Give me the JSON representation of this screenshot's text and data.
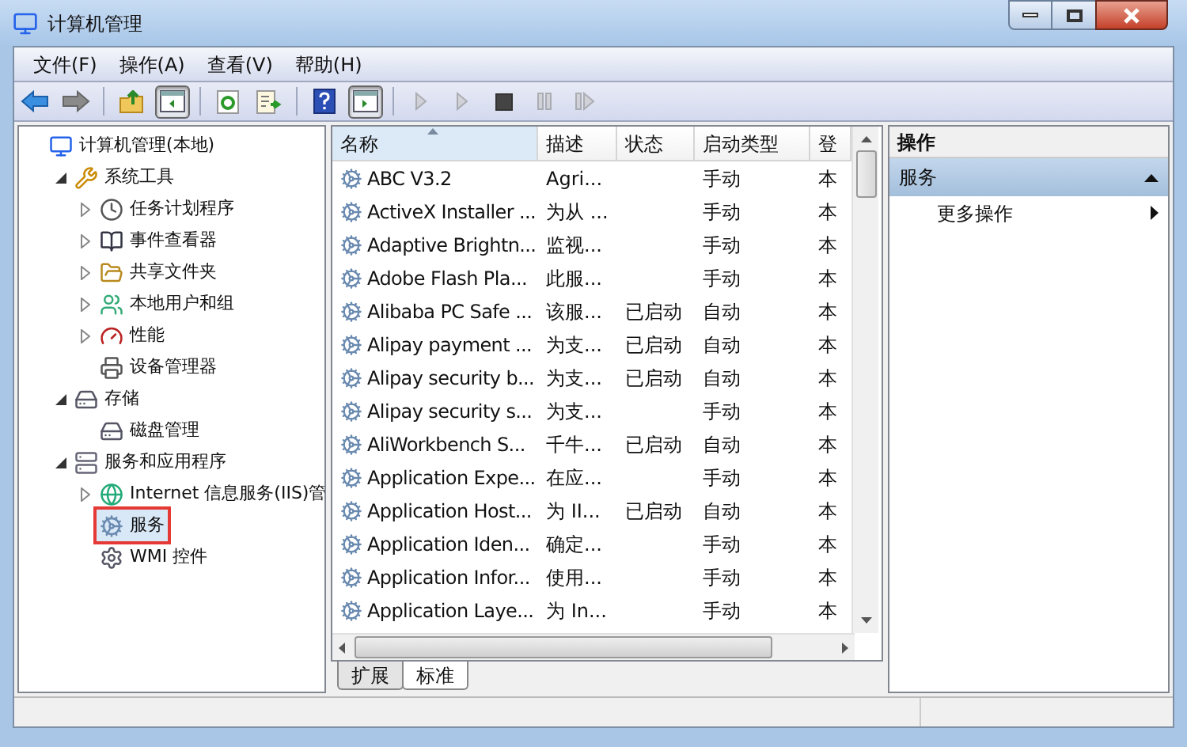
{
  "window": {
    "title": "计算机管理"
  },
  "menu": [
    "文件(F)",
    "操作(A)",
    "查看(V)",
    "帮助(H)"
  ],
  "toolbar": [
    {
      "kind": "back",
      "pressed": false,
      "disabled": false
    },
    {
      "kind": "forward",
      "pressed": false,
      "disabled": false
    },
    {
      "kind": "sep"
    },
    {
      "kind": "up",
      "pressed": false,
      "disabled": false
    },
    {
      "kind": "tree",
      "pressed": true,
      "disabled": false
    },
    {
      "kind": "sep"
    },
    {
      "kind": "refresh",
      "pressed": false,
      "disabled": false
    },
    {
      "kind": "export",
      "pressed": false,
      "disabled": false
    },
    {
      "kind": "sep"
    },
    {
      "kind": "help",
      "pressed": false,
      "disabled": false
    },
    {
      "kind": "pane",
      "pressed": true,
      "disabled": false
    },
    {
      "kind": "sep"
    },
    {
      "kind": "play",
      "pressed": false,
      "disabled": true
    },
    {
      "kind": "play",
      "pressed": false,
      "disabled": true
    },
    {
      "kind": "stop",
      "pressed": false,
      "disabled": false
    },
    {
      "kind": "pause",
      "pressed": false,
      "disabled": true
    },
    {
      "kind": "resume",
      "pressed": false,
      "disabled": true
    }
  ],
  "tree": [
    {
      "label": "计算机管理(本地)",
      "kind": "node",
      "selected": false,
      "marked": false,
      "children": [
        {
          "label": "系统工具",
          "kind": "branch",
          "expanded": true,
          "selected": false,
          "marked": false,
          "children": [
            {
              "label": "任务计划程序",
              "kind": "branch",
              "expanded": false,
              "selected": false,
              "marked": false
            },
            {
              "label": "事件查看器",
              "kind": "branch",
              "expanded": false,
              "selected": false,
              "marked": false
            },
            {
              "label": "共享文件夹",
              "kind": "branch",
              "expanded": false,
              "selected": false,
              "marked": false
            },
            {
              "label": "本地用户和组",
              "kind": "branch",
              "expanded": false,
              "selected": false,
              "marked": false
            },
            {
              "label": "性能",
              "kind": "branch",
              "expanded": false,
              "selected": false,
              "marked": false
            },
            {
              "label": "设备管理器",
              "kind": "node",
              "selected": false,
              "marked": false
            }
          ]
        },
        {
          "label": "存储",
          "kind": "branch",
          "expanded": true,
          "selected": false,
          "marked": false,
          "children": [
            {
              "label": "磁盘管理",
              "kind": "node",
              "selected": false,
              "marked": false
            }
          ]
        },
        {
          "label": "服务和应用程序",
          "kind": "branch",
          "expanded": true,
          "selected": false,
          "marked": false,
          "children": [
            {
              "label": "Internet 信息服务(IIS)管",
              "kind": "branch",
              "expanded": false,
              "selected": false,
              "marked": false
            },
            {
              "label": "服务",
              "kind": "node",
              "selected": true,
              "marked": true
            },
            {
              "label": "WMI 控件",
              "kind": "node",
              "selected": false,
              "marked": false
            }
          ]
        }
      ]
    }
  ],
  "table": {
    "columns": [
      {
        "label": "名称",
        "sorted": true
      },
      {
        "label": "描述",
        "sorted": false
      },
      {
        "label": "状态",
        "sorted": false
      },
      {
        "label": "启动类型",
        "sorted": false
      },
      {
        "label": "登",
        "sorted": false
      }
    ],
    "rows": [
      [
        "ABC V3.2",
        "Agri...",
        "",
        "手动",
        "本"
      ],
      [
        "ActiveX Installer ...",
        "为从 ...",
        "",
        "手动",
        "本"
      ],
      [
        "Adaptive Brightn...",
        "监视...",
        "",
        "手动",
        "本"
      ],
      [
        "Adobe Flash Pla...",
        "此服...",
        "",
        "手动",
        "本"
      ],
      [
        "Alibaba PC Safe ...",
        "该服...",
        "已启动",
        "自动",
        "本"
      ],
      [
        "Alipay payment ...",
        "为支...",
        "已启动",
        "自动",
        "本"
      ],
      [
        "Alipay security b...",
        "为支...",
        "已启动",
        "自动",
        "本"
      ],
      [
        "Alipay security s...",
        "为支...",
        "",
        "手动",
        "本"
      ],
      [
        "AliWorkbench S...",
        "千牛...",
        "已启动",
        "自动",
        "本"
      ],
      [
        "Application Expe...",
        "在应...",
        "",
        "手动",
        "本"
      ],
      [
        "Application Host...",
        "为 II...",
        "已启动",
        "自动",
        "本"
      ],
      [
        "Application Iden...",
        "确定...",
        "",
        "手动",
        "本"
      ],
      [
        "Application Infor...",
        "使用...",
        "",
        "手动",
        "本"
      ],
      [
        "Application Laye...",
        "为 In...",
        "",
        "手动",
        "本"
      ]
    ]
  },
  "view_tabs": [
    {
      "label": "扩展",
      "selected": false
    },
    {
      "label": "标准",
      "selected": true
    }
  ],
  "actions": {
    "title": "操作",
    "section": {
      "label": "服务",
      "expanded": true
    },
    "items": [
      {
        "label": "更多操作"
      }
    ]
  },
  "status_bar": {
    "visible": true
  }
}
